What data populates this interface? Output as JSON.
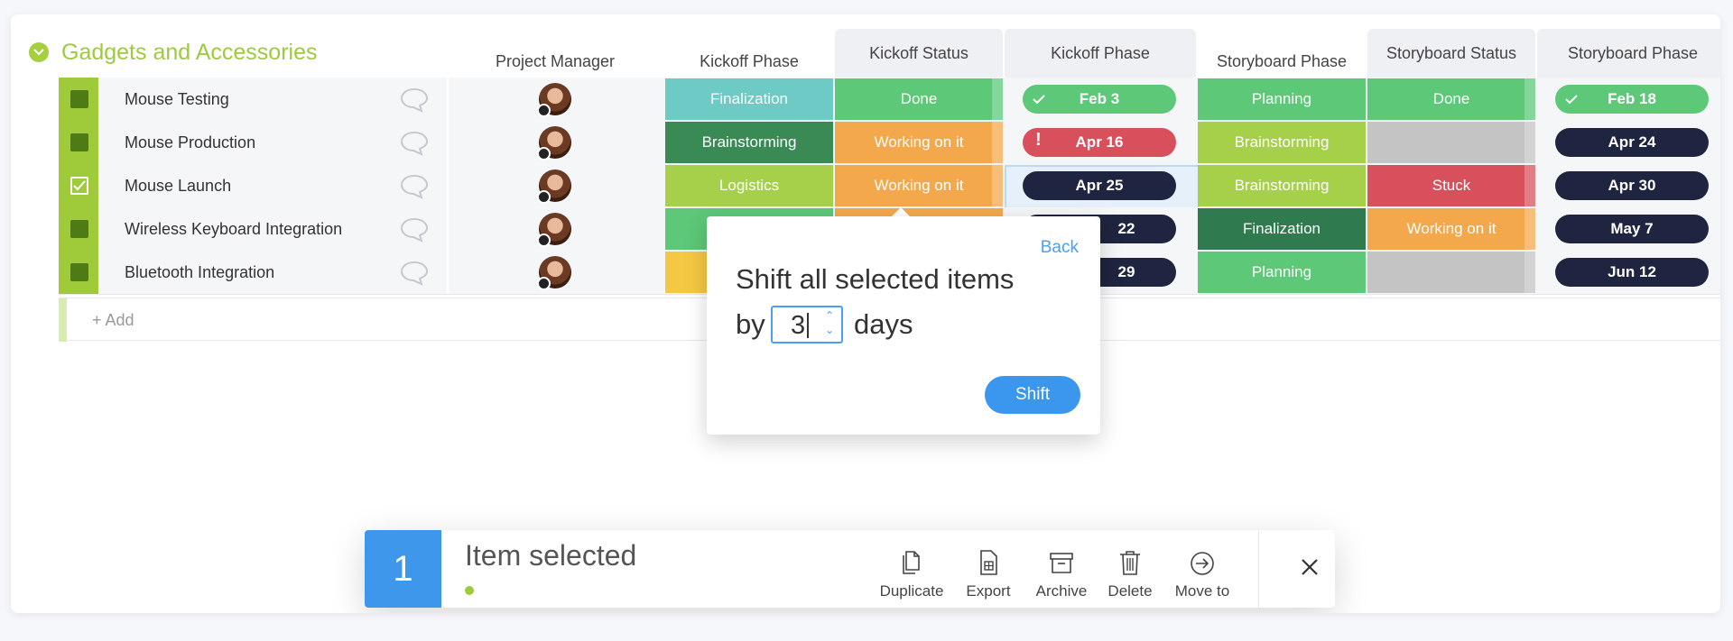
{
  "group": {
    "title": "Gadgets and Accessories"
  },
  "columns": [
    "Project Manager",
    "Kickoff Phase",
    "Kickoff Status",
    "Kickoff Phase",
    "Storyboard Phase",
    "Storyboard Status",
    "Storyboard Phase"
  ],
  "rows": [
    {
      "name": "Mouse Testing",
      "checked": false,
      "kickoff_phase": "Finalization",
      "kickoff_status": "Done",
      "kickoff_date": "Feb 3",
      "storyboard_phase": "Planning",
      "storyboard_status": "Done",
      "storyboard_date": "Feb 18"
    },
    {
      "name": "Mouse Production",
      "checked": false,
      "kickoff_phase": "Brainstorming",
      "kickoff_status": "Working on it",
      "kickoff_date": "Apr 16",
      "storyboard_phase": "Brainstorming",
      "storyboard_status": "",
      "storyboard_date": "Apr 24"
    },
    {
      "name": "Mouse Launch",
      "checked": true,
      "kickoff_phase": "Logistics",
      "kickoff_status": "Working on it",
      "kickoff_date": "Apr 25",
      "storyboard_phase": "Brainstorming",
      "storyboard_status": "Stuck",
      "storyboard_date": "Apr 30"
    },
    {
      "name": "Wireless Keyboard Integration",
      "checked": false,
      "kickoff_phase": "",
      "kickoff_status": "",
      "kickoff_date": "22",
      "storyboard_phase": "Finalization",
      "storyboard_status": "Working on it",
      "storyboard_date": "May 7"
    },
    {
      "name": "Bluetooth Integration",
      "checked": false,
      "kickoff_phase": "",
      "kickoff_status": "",
      "kickoff_date": "29",
      "storyboard_phase": "Planning",
      "storyboard_status": "",
      "storyboard_date": "Jun 12"
    }
  ],
  "add_row": {
    "label": "+ Add"
  },
  "popover": {
    "back": "Back",
    "heading": "Shift all selected items",
    "by": "by",
    "days_value": "3",
    "days_label": "days",
    "shift_button": "Shift"
  },
  "action_bar": {
    "count": "1",
    "label": "Item selected",
    "actions": [
      "Duplicate",
      "Export",
      "Archive",
      "Delete",
      "Move to"
    ]
  },
  "colors": {
    "accent_green": "#9fcb3a",
    "done_green": "#5cc878",
    "working_orange": "#f3a94b",
    "stuck_red": "#d9505d",
    "primary_blue": "#3b96ee",
    "date_dark": "#1f2440"
  }
}
